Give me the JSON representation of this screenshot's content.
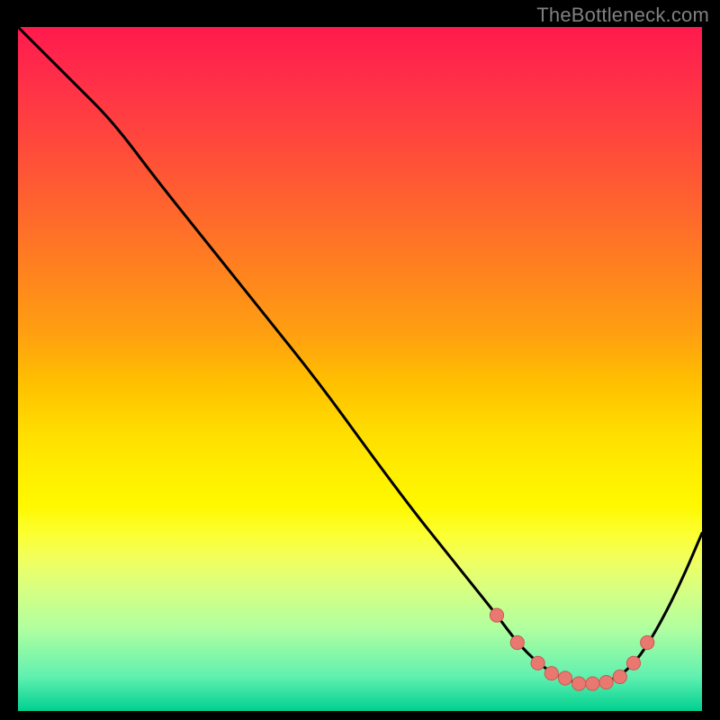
{
  "attribution": "TheBottleneck.com",
  "chart_data": {
    "type": "line",
    "title": "",
    "xlabel": "",
    "ylabel": "",
    "xlim": [
      0,
      100
    ],
    "ylim": [
      0,
      100
    ],
    "series": [
      {
        "name": "bottleneck-curve",
        "x": [
          0,
          3,
          8,
          14,
          20,
          28,
          36,
          44,
          52,
          58,
          62,
          66,
          70,
          73,
          76,
          79,
          82,
          85,
          88,
          91,
          94,
          97,
          100
        ],
        "y": [
          100,
          97,
          92,
          86,
          78,
          68,
          58,
          48,
          37,
          29,
          24,
          19,
          14,
          10,
          7,
          5,
          4,
          4,
          5,
          8,
          13,
          19,
          26
        ]
      }
    ],
    "markers": {
      "name": "highlighted-points",
      "x": [
        70,
        73,
        76,
        78,
        80,
        82,
        84,
        86,
        88,
        90,
        92
      ],
      "y": [
        14,
        10,
        7,
        5.5,
        4.8,
        4,
        4,
        4.2,
        5,
        7,
        10
      ]
    },
    "gradient_stops": [
      {
        "pos": 0,
        "color": "#ff1a4d"
      },
      {
        "pos": 50,
        "color": "#ffc000"
      },
      {
        "pos": 75,
        "color": "#fcff30"
      },
      {
        "pos": 100,
        "color": "#00d090"
      }
    ]
  }
}
